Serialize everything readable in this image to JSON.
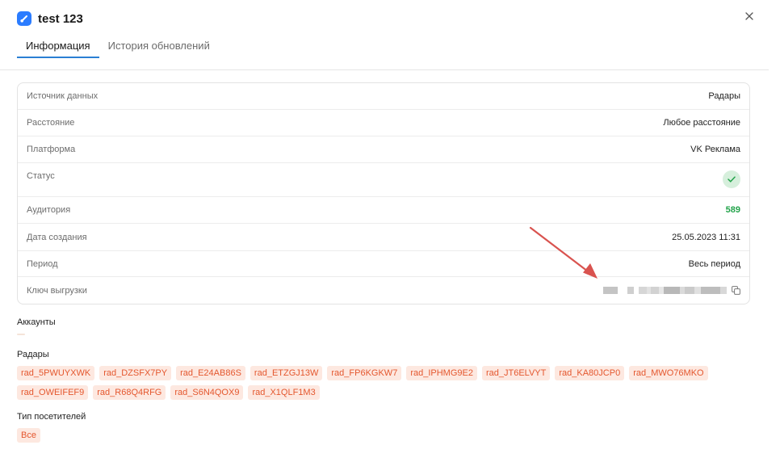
{
  "header": {
    "title": "test 123",
    "app_icon": "app-logo-icon",
    "close_icon": "close-icon"
  },
  "tabs": [
    {
      "label": "Информация",
      "active": true
    },
    {
      "label": "История обновлений",
      "active": false
    }
  ],
  "info": {
    "source": {
      "label": "Источник данных",
      "value": "Радары"
    },
    "distance": {
      "label": "Расстояние",
      "value": "Любое расстояние"
    },
    "platform": {
      "label": "Платформа",
      "value": "VK Реклама"
    },
    "status": {
      "label": "Статус",
      "icon": "check-icon",
      "color": "#22a34a"
    },
    "audience": {
      "label": "Аудитория",
      "value": "589"
    },
    "created": {
      "label": "Дата создания",
      "value": "25.05.2023 11:31"
    },
    "period": {
      "label": "Период",
      "value": "Весь период"
    },
    "export_key": {
      "label": "Ключ выгрузки",
      "icon": "copy-icon",
      "blurred": true
    }
  },
  "accounts": {
    "title": "Аккаунты"
  },
  "radars": {
    "title": "Радары",
    "items": [
      "rad_5PWUYXWK",
      "rad_DZSFX7PY",
      "rad_E24AB86S",
      "rad_ETZGJ13W",
      "rad_FP6KGKW7",
      "rad_IPHMG9E2",
      "rad_JT6ELVYT",
      "rad_KA80JCP0",
      "rad_MWO76MKO",
      "rad_OWEIFEF9",
      "rad_R68Q4RFG",
      "rad_S6N4QOX9",
      "rad_X1QLF1M3"
    ]
  },
  "visitor_type": {
    "title": "Тип посетителей",
    "items": [
      "Все"
    ]
  },
  "colors": {
    "accent": "#2a7fd4",
    "chip_bg": "#fde8e0",
    "chip_text": "#e4572e",
    "annotation_arrow": "#d9534f"
  }
}
